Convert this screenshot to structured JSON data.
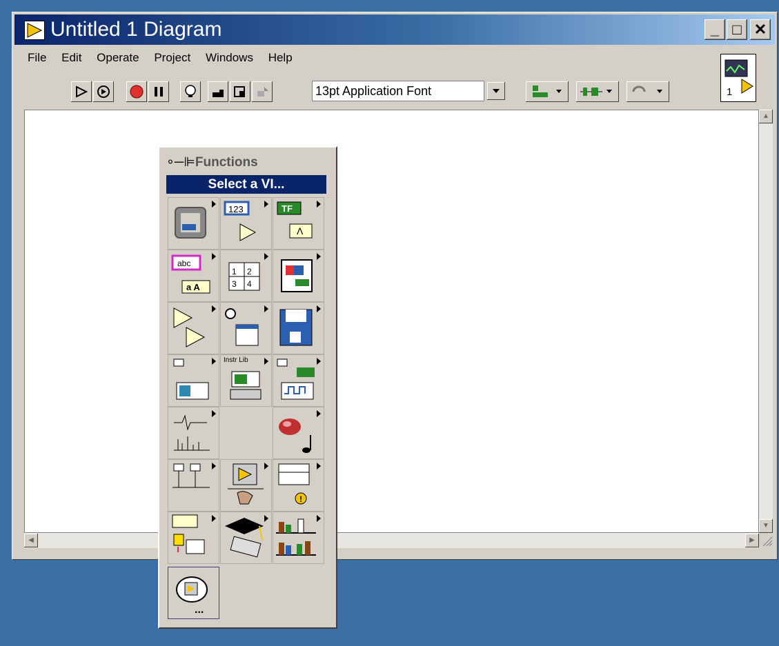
{
  "window": {
    "title": "Untitled 1 Diagram",
    "controls": {
      "minimize": "_",
      "maximize": "□",
      "close": "✕"
    }
  },
  "menu": {
    "items": [
      "File",
      "Edit",
      "Operate",
      "Project",
      "Windows",
      "Help"
    ]
  },
  "toolbar": {
    "font_select": "13pt Application Font",
    "buttons": [
      "run-icon",
      "run-continuous-icon",
      "abort-icon",
      "pause-icon",
      "highlight-execution-icon",
      "step-into-icon",
      "step-over-icon",
      "step-out-icon"
    ],
    "align_dropdowns": [
      "align-objects-icon",
      "distribute-objects-icon",
      "reorder-icon"
    ]
  },
  "connector_pane": {
    "label": "1"
  },
  "palette": {
    "title": "Functions",
    "select_vi": "Select a VI...",
    "items": [
      {
        "name": "structures-icon"
      },
      {
        "name": "numeric-icon",
        "label": "123"
      },
      {
        "name": "boolean-icon",
        "label": "TF"
      },
      {
        "name": "string-icon",
        "label": "abc"
      },
      {
        "name": "array-cluster-icon",
        "label": "1 2 3 4"
      },
      {
        "name": "cluster-icon"
      },
      {
        "name": "comparison-icon"
      },
      {
        "name": "time-dialog-icon"
      },
      {
        "name": "file-io-icon"
      },
      {
        "name": "data-acquisition-icon"
      },
      {
        "name": "instrument-library-icon",
        "label": "Instr Lib"
      },
      {
        "name": "instrument-io-icon"
      },
      {
        "name": "analyze-icon"
      },
      {
        "name": "empty-slot"
      },
      {
        "name": "graphics-sound-icon"
      },
      {
        "name": "communication-icon"
      },
      {
        "name": "application-control-icon"
      },
      {
        "name": "advanced-icon"
      },
      {
        "name": "report-generation-icon"
      },
      {
        "name": "tutorial-icon"
      },
      {
        "name": "user-libraries-icon"
      },
      {
        "name": "select-vi-icon"
      }
    ]
  },
  "colors": {
    "desktop": "#3a6ea5",
    "titlebar": "#0a246a",
    "accent": "#0a246a"
  }
}
